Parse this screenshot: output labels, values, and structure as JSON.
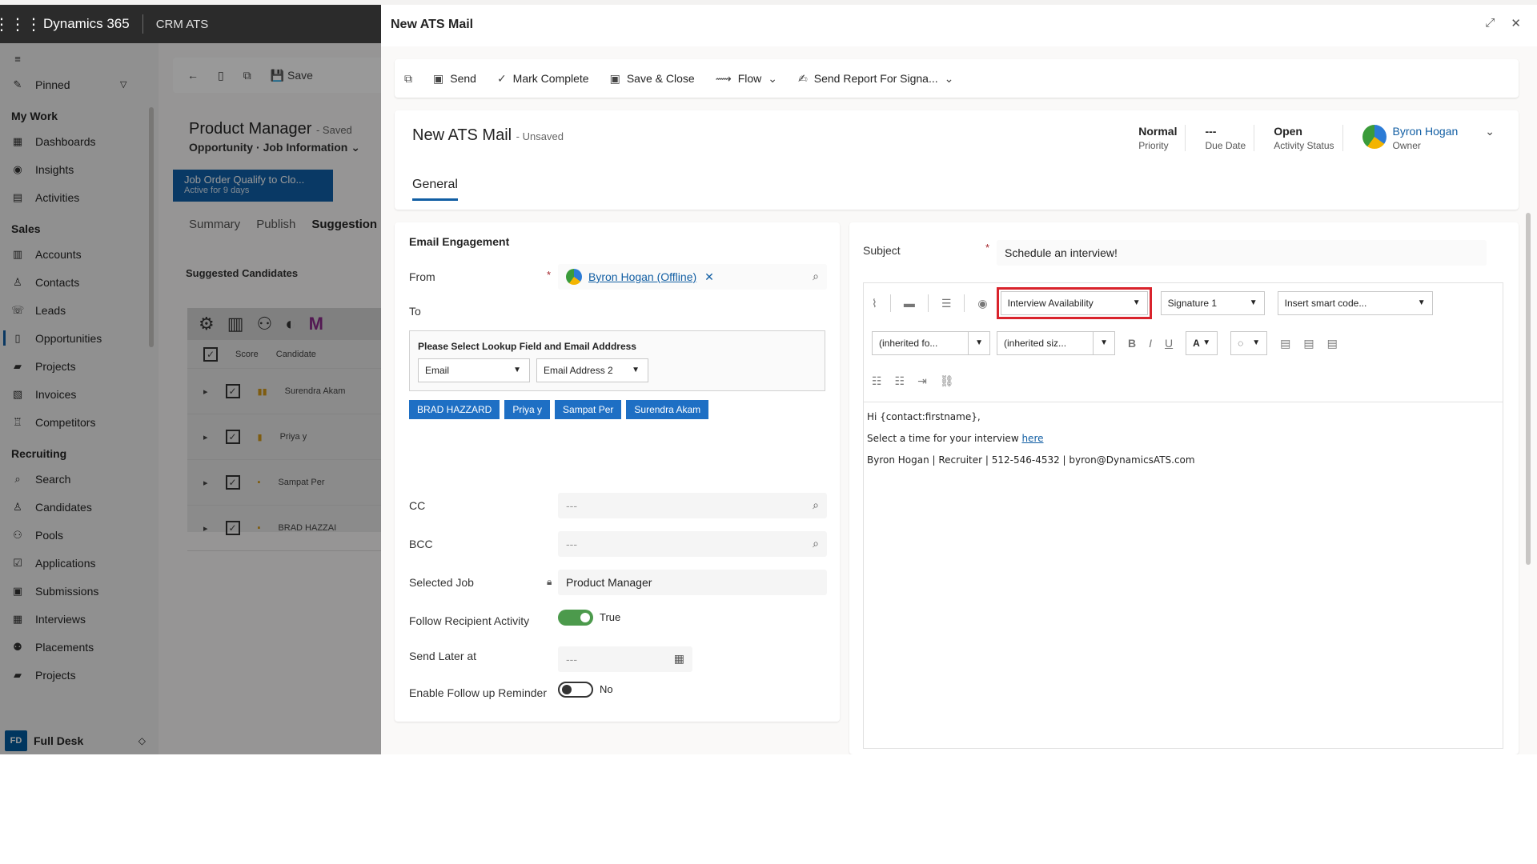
{
  "app": {
    "brand": "Dynamics 365",
    "name": "CRM ATS"
  },
  "nav": {
    "pinned": "Pinned",
    "sections": [
      {
        "title": "My Work",
        "items": [
          "Dashboards",
          "Insights",
          "Activities"
        ]
      },
      {
        "title": "Sales",
        "items": [
          "Accounts",
          "Contacts",
          "Leads",
          "Opportunities",
          "Projects",
          "Invoices",
          "Competitors"
        ]
      },
      {
        "title": "Recruiting",
        "items": [
          "Search",
          "Candidates",
          "Pools",
          "Applications",
          "Submissions",
          "Interviews",
          "Placements",
          "Projects"
        ]
      }
    ],
    "footer": {
      "initials": "FD",
      "label": "Full Desk"
    }
  },
  "background": {
    "save": "Save",
    "title": "Product Manager",
    "status": "- Saved",
    "entity": "Opportunity",
    "form": "Job Information",
    "stage": "Job Order Qualify to Clo...",
    "stage_sub": "Active for 9 days",
    "tabs": [
      "Summary",
      "Publish",
      "Suggestion"
    ],
    "suggested": "Suggested Candidates",
    "grid_headers": [
      "Score",
      "Candidate"
    ],
    "grid_rows": [
      "Surendra Akam",
      "Priya y",
      "Sampat Per",
      "BRAD HAZZAI"
    ]
  },
  "panel": {
    "title": "New ATS Mail",
    "commands": [
      "Send",
      "Mark Complete",
      "Save & Close",
      "Flow",
      "Send Report For Signa..."
    ],
    "record_title": "New ATS Mail",
    "record_status": "- Unsaved",
    "header_fields": [
      {
        "value": "Normal",
        "label": "Priority"
      },
      {
        "value": "---",
        "label": "Due Date"
      },
      {
        "value": "Open",
        "label": "Activity Status"
      }
    ],
    "owner": {
      "name": "Byron Hogan",
      "label": "Owner"
    },
    "tab": "General"
  },
  "engagement": {
    "section": "Email Engagement",
    "from_label": "From",
    "from_value": "Byron Hogan (Offline)",
    "to_label": "To",
    "lookup_title": "Please Select Lookup Field and Email Adddress",
    "lookup_field": "Email",
    "email_field": "Email Address 2",
    "recipients": [
      "BRAD HAZZARD",
      "Priya y",
      "Sampat Per",
      "Surendra Akam"
    ],
    "cc_label": "CC",
    "cc_value": "---",
    "bcc_label": "BCC",
    "bcc_value": "---",
    "job_label": "Selected Job",
    "job_value": "Product Manager",
    "follow_label": "Follow Recipient Activity",
    "follow_value": "True",
    "send_later_label": "Send Later at",
    "send_later_value": "---",
    "reminder_label": "Enable Follow up Reminder",
    "reminder_value": "No"
  },
  "email": {
    "subject_label": "Subject",
    "subject_value": "Schedule an interview!",
    "template": "Interview Availability",
    "signature": "Signature 1",
    "smart_code": "Insert smart code...",
    "font": "(inherited fo...",
    "size": "(inherited siz...",
    "body_line1": "Hi {contact:firstname},",
    "body_line2": "Select a time for your interview ",
    "body_link": "here",
    "body_line3": "Byron Hogan | Recruiter | 512-546-4532 | byron@DynamicsATS.com"
  },
  "colors": {
    "accent": "#115ea3",
    "highlight": "#d9232c",
    "chip": "#1e6fc4",
    "toggle_on": "#4c9a4c"
  }
}
